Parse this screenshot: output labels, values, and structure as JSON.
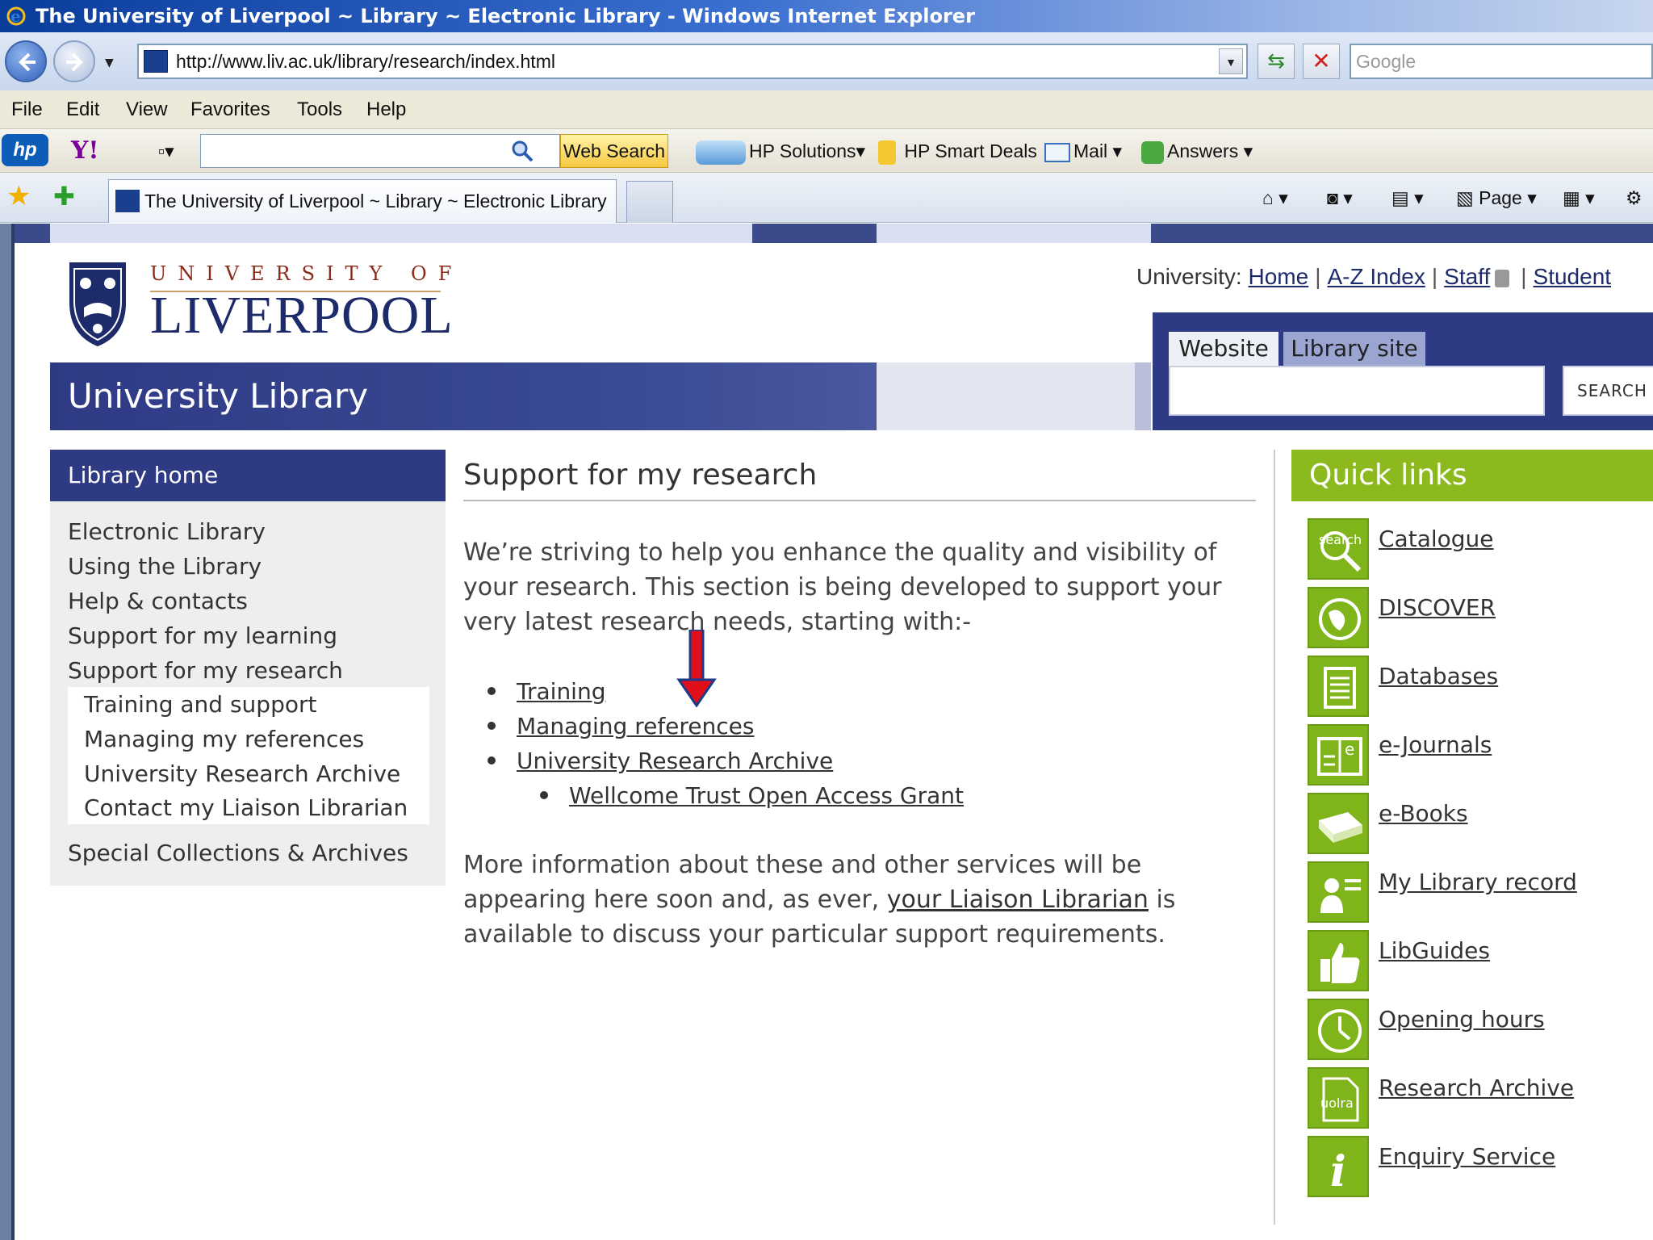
{
  "window": {
    "title": "The University of Liverpool ~ Library ~ Electronic Library - Windows Internet Explorer"
  },
  "address_bar": {
    "url": "http://www.liv.ac.uk/library/research/index.html",
    "search_placeholder": "Google"
  },
  "menu": [
    "File",
    "Edit",
    "View",
    "Favorites",
    "Tools",
    "Help"
  ],
  "toolbar": {
    "web_search": "Web Search",
    "hp_solutions": "HP Solutions",
    "smart_deals": "HP Smart Deals",
    "mail": "Mail",
    "answers": "Answers"
  },
  "tabs": {
    "active_tab": "The University of Liverpool ~ Library ~ Electronic Library"
  },
  "command_bar": {
    "page": "Page"
  },
  "header": {
    "uni_top": "UNIVERSITY OF",
    "uni_main": "LIVERPOOL",
    "univ_label": "University:",
    "links": [
      "Home",
      "A-Z Index",
      "Staff",
      "Student"
    ]
  },
  "banner": {
    "title": "University Library"
  },
  "site_search": {
    "tab_website": "Website",
    "tab_library": "Library site",
    "button": "SEARCH"
  },
  "left_nav": {
    "home": "Library home",
    "items": [
      "Electronic Library",
      "Using the Library",
      "Help & contacts",
      "Support for my learning",
      "Support for my research"
    ],
    "sub_items": [
      "Training and support",
      "Managing my references",
      "University Research Archive",
      "Contact my Liaison Librarian"
    ],
    "last_item": "Special Collections & Archives"
  },
  "content": {
    "title": "Support for my research",
    "intro": "We’re striving to help you enhance the quality and visibility of your research. This section is being developed to support your very latest research needs, starting with:-",
    "bullets": [
      "Training",
      "Managing references",
      "University Research Archive"
    ],
    "sub_bullet": "Wellcome Trust Open Access Grant",
    "outro_before": "More information about these and other services will be appearing here soon and, as ever, ",
    "outro_link": "your Liaison Librarian",
    "outro_after": " is available to discuss your particular support requirements."
  },
  "quick_links": {
    "heading": "Quick links",
    "items": [
      {
        "label": "Catalogue",
        "icon": "search-icon",
        "icon_text": "search"
      },
      {
        "label": "DISCOVER",
        "icon": "globe-icon"
      },
      {
        "label": "Databases",
        "icon": "list-icon"
      },
      {
        "label": "e-Journals",
        "icon": "journal-icon",
        "icon_text": "e"
      },
      {
        "label": "e-Books",
        "icon": "book-icon"
      },
      {
        "label": "My Library record",
        "icon": "person-icon"
      },
      {
        "label": "LibGuides",
        "icon": "thumbs-up-icon"
      },
      {
        "label": "Opening hours",
        "icon": "clock-icon"
      },
      {
        "label": "Research Archive",
        "icon": "document-icon",
        "icon_text": "uolra"
      },
      {
        "label": "Enquiry Service",
        "icon": "info-icon",
        "icon_text": "i"
      }
    ]
  },
  "colors": {
    "brand_blue": "#2f3a85",
    "quick_links_green": "#8cba1e",
    "arrow_red": "#e0101a"
  }
}
